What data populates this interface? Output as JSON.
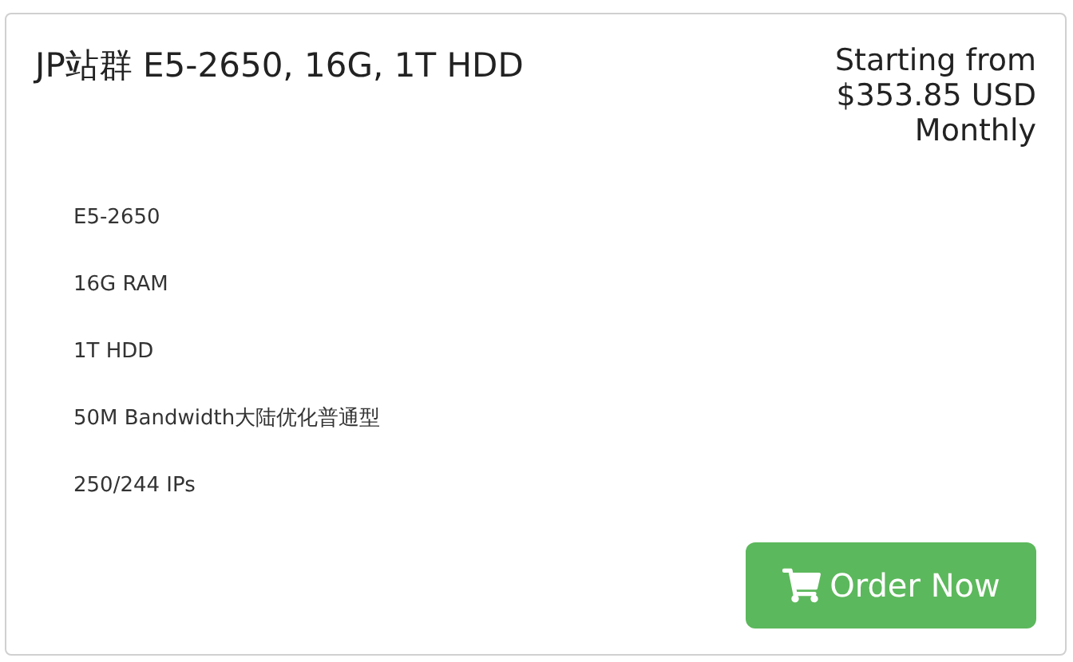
{
  "product": {
    "title": "JP站群 E5-2650, 16G, 1T HDD",
    "price_lines": [
      "Starting from",
      "$353.85 USD",
      "Monthly"
    ],
    "features": [
      "E5-2650",
      "16G RAM",
      "1T HDD",
      "50M Bandwidth大陆优化普通型",
      "250/244 IPs"
    ],
    "order_button": "Order Now"
  }
}
